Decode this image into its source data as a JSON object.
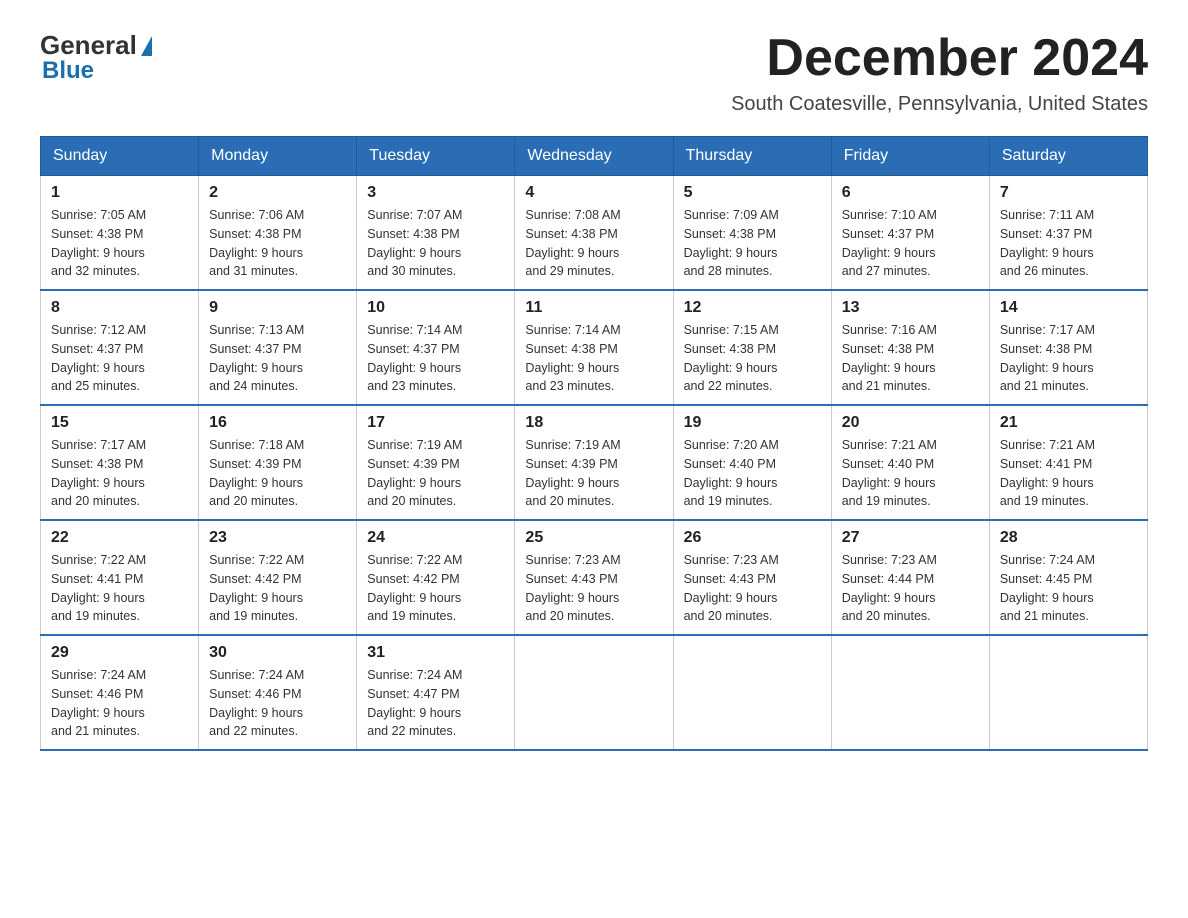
{
  "header": {
    "logo_general": "General",
    "logo_blue": "Blue",
    "title": "December 2024",
    "subtitle": "South Coatesville, Pennsylvania, United States"
  },
  "calendar": {
    "days_of_week": [
      "Sunday",
      "Monday",
      "Tuesday",
      "Wednesday",
      "Thursday",
      "Friday",
      "Saturday"
    ],
    "weeks": [
      [
        {
          "day": "1",
          "sunrise": "7:05 AM",
          "sunset": "4:38 PM",
          "daylight": "9 hours and 32 minutes."
        },
        {
          "day": "2",
          "sunrise": "7:06 AM",
          "sunset": "4:38 PM",
          "daylight": "9 hours and 31 minutes."
        },
        {
          "day": "3",
          "sunrise": "7:07 AM",
          "sunset": "4:38 PM",
          "daylight": "9 hours and 30 minutes."
        },
        {
          "day": "4",
          "sunrise": "7:08 AM",
          "sunset": "4:38 PM",
          "daylight": "9 hours and 29 minutes."
        },
        {
          "day": "5",
          "sunrise": "7:09 AM",
          "sunset": "4:38 PM",
          "daylight": "9 hours and 28 minutes."
        },
        {
          "day": "6",
          "sunrise": "7:10 AM",
          "sunset": "4:37 PM",
          "daylight": "9 hours and 27 minutes."
        },
        {
          "day": "7",
          "sunrise": "7:11 AM",
          "sunset": "4:37 PM",
          "daylight": "9 hours and 26 minutes."
        }
      ],
      [
        {
          "day": "8",
          "sunrise": "7:12 AM",
          "sunset": "4:37 PM",
          "daylight": "9 hours and 25 minutes."
        },
        {
          "day": "9",
          "sunrise": "7:13 AM",
          "sunset": "4:37 PM",
          "daylight": "9 hours and 24 minutes."
        },
        {
          "day": "10",
          "sunrise": "7:14 AM",
          "sunset": "4:37 PM",
          "daylight": "9 hours and 23 minutes."
        },
        {
          "day": "11",
          "sunrise": "7:14 AM",
          "sunset": "4:38 PM",
          "daylight": "9 hours and 23 minutes."
        },
        {
          "day": "12",
          "sunrise": "7:15 AM",
          "sunset": "4:38 PM",
          "daylight": "9 hours and 22 minutes."
        },
        {
          "day": "13",
          "sunrise": "7:16 AM",
          "sunset": "4:38 PM",
          "daylight": "9 hours and 21 minutes."
        },
        {
          "day": "14",
          "sunrise": "7:17 AM",
          "sunset": "4:38 PM",
          "daylight": "9 hours and 21 minutes."
        }
      ],
      [
        {
          "day": "15",
          "sunrise": "7:17 AM",
          "sunset": "4:38 PM",
          "daylight": "9 hours and 20 minutes."
        },
        {
          "day": "16",
          "sunrise": "7:18 AM",
          "sunset": "4:39 PM",
          "daylight": "9 hours and 20 minutes."
        },
        {
          "day": "17",
          "sunrise": "7:19 AM",
          "sunset": "4:39 PM",
          "daylight": "9 hours and 20 minutes."
        },
        {
          "day": "18",
          "sunrise": "7:19 AM",
          "sunset": "4:39 PM",
          "daylight": "9 hours and 20 minutes."
        },
        {
          "day": "19",
          "sunrise": "7:20 AM",
          "sunset": "4:40 PM",
          "daylight": "9 hours and 19 minutes."
        },
        {
          "day": "20",
          "sunrise": "7:21 AM",
          "sunset": "4:40 PM",
          "daylight": "9 hours and 19 minutes."
        },
        {
          "day": "21",
          "sunrise": "7:21 AM",
          "sunset": "4:41 PM",
          "daylight": "9 hours and 19 minutes."
        }
      ],
      [
        {
          "day": "22",
          "sunrise": "7:22 AM",
          "sunset": "4:41 PM",
          "daylight": "9 hours and 19 minutes."
        },
        {
          "day": "23",
          "sunrise": "7:22 AM",
          "sunset": "4:42 PM",
          "daylight": "9 hours and 19 minutes."
        },
        {
          "day": "24",
          "sunrise": "7:22 AM",
          "sunset": "4:42 PM",
          "daylight": "9 hours and 19 minutes."
        },
        {
          "day": "25",
          "sunrise": "7:23 AM",
          "sunset": "4:43 PM",
          "daylight": "9 hours and 20 minutes."
        },
        {
          "day": "26",
          "sunrise": "7:23 AM",
          "sunset": "4:43 PM",
          "daylight": "9 hours and 20 minutes."
        },
        {
          "day": "27",
          "sunrise": "7:23 AM",
          "sunset": "4:44 PM",
          "daylight": "9 hours and 20 minutes."
        },
        {
          "day": "28",
          "sunrise": "7:24 AM",
          "sunset": "4:45 PM",
          "daylight": "9 hours and 21 minutes."
        }
      ],
      [
        {
          "day": "29",
          "sunrise": "7:24 AM",
          "sunset": "4:46 PM",
          "daylight": "9 hours and 21 minutes."
        },
        {
          "day": "30",
          "sunrise": "7:24 AM",
          "sunset": "4:46 PM",
          "daylight": "9 hours and 22 minutes."
        },
        {
          "day": "31",
          "sunrise": "7:24 AM",
          "sunset": "4:47 PM",
          "daylight": "9 hours and 22 minutes."
        },
        null,
        null,
        null,
        null
      ]
    ],
    "labels": {
      "sunrise": "Sunrise:",
      "sunset": "Sunset:",
      "daylight": "Daylight:"
    }
  }
}
